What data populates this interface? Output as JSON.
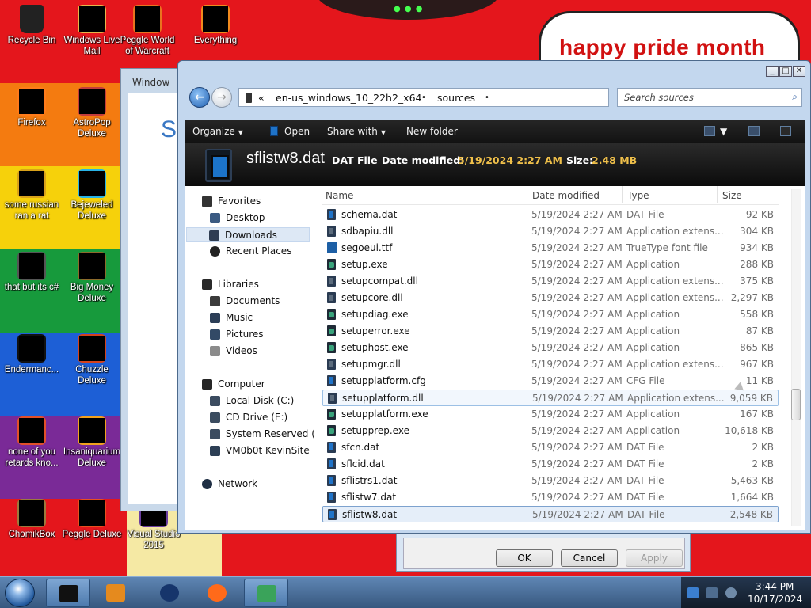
{
  "desktop": {
    "banner_text": "happy pride month",
    "icons": [
      {
        "label": "Recycle Bin",
        "icon": "recycle-bin-icon",
        "color": "#222222"
      },
      {
        "label": "Windows Live Mail",
        "icon": "mail-icon",
        "color": "#e7b54b"
      },
      {
        "label": "Peggle World of Warcraft",
        "icon": "peggle-wow-icon",
        "color": "#e9731f"
      },
      {
        "label": "Everything",
        "icon": "magnifier-icon",
        "color": "#f08a1d"
      },
      {
        "label": "Firefox",
        "icon": "firefox-icon",
        "color": "#ff7b1a"
      },
      {
        "label": "AstroPop Deluxe",
        "icon": "astropop-icon",
        "color": "#c43c3c"
      },
      {
        "label": "some russian ran a rat",
        "icon": "shortcut-icon",
        "color": "#d9a21a"
      },
      {
        "label": "Bejeweled Deluxe",
        "icon": "gem-icon",
        "color": "#29b3e6"
      },
      {
        "label": "that but its c#",
        "icon": "windows-stack-icon",
        "color": "#555555"
      },
      {
        "label": "Big Money Deluxe",
        "icon": "money-bag-icon",
        "color": "#8c6a2b"
      },
      {
        "label": "Endermanc...",
        "icon": "terminal-icon",
        "color": "#111111"
      },
      {
        "label": "Chuzzle Deluxe",
        "icon": "chuzzle-icon",
        "color": "#d4421b"
      },
      {
        "label": "none of you retards kno...",
        "icon": "orange-ball-icon",
        "color": "#e2502a"
      },
      {
        "label": "Insaniquarium Deluxe",
        "icon": "fish-icon",
        "color": "#f2a21f"
      },
      {
        "label": "ChomikBox",
        "icon": "hamster-icon",
        "color": "#9c7a3d"
      },
      {
        "label": "Peggle Deluxe",
        "icon": "peggle-icon",
        "color": "#e8501f"
      },
      {
        "label": "Visual Studio 2015",
        "icon": "visual-studio-icon",
        "color": "#6b3fa0"
      }
    ]
  },
  "background_window": {
    "title": "Window",
    "heading_letter": "Se"
  },
  "properties_dialog": {
    "ok": "OK",
    "cancel": "Cancel",
    "apply": "Apply"
  },
  "explorer": {
    "window_controls": {
      "minimize": "_",
      "maximize": "□",
      "close": "✕"
    },
    "back": "←",
    "forward": "→",
    "address": {
      "chevron": "«",
      "crumbs": [
        "en-us_windows_10_22h2_x64",
        "sources"
      ],
      "separator": "•",
      "dropdown": "▼",
      "refresh": "↻"
    },
    "search": {
      "placeholder": "Search sources",
      "icon": "⌕"
    },
    "toolbar": {
      "organize": "Organize",
      "open": "Open",
      "share_with": "Share with",
      "new_folder": "New folder",
      "caret": "▼"
    },
    "details": {
      "name": "sflistw8.dat",
      "type": "DAT File",
      "modified_label": "Date modified:",
      "modified_value": "5/19/2024 2:27 AM",
      "size_label": "Size:",
      "size_value": "2.48 MB"
    },
    "nav": {
      "favorites": "Favorites",
      "desktop": "Desktop",
      "downloads": "Downloads",
      "recent_places": "Recent Places",
      "libraries": "Libraries",
      "documents": "Documents",
      "music": "Music",
      "pictures": "Pictures",
      "videos": "Videos",
      "computer": "Computer",
      "local_disk": "Local Disk (C:)",
      "cd_drive": "CD Drive (E:)",
      "system_reserved": "System Reserved (F:)",
      "vmshare": "VM0b0t KevinSite",
      "network": "Network"
    },
    "columns": {
      "name": "Name",
      "date": "Date modified",
      "type": "Type",
      "size": "Size",
      "sort_arrow": "^"
    },
    "files": [
      {
        "name": "schema.dat",
        "date": "5/19/2024 2:27 AM",
        "type": "DAT File",
        "size": "92 KB",
        "kind": "dat"
      },
      {
        "name": "sdbapiu.dll",
        "date": "5/19/2024 2:27 AM",
        "type": "Application extens...",
        "size": "304 KB",
        "kind": "dll"
      },
      {
        "name": "segoeui.ttf",
        "date": "5/19/2024 2:27 AM",
        "type": "TrueType font file",
        "size": "934 KB",
        "kind": "font"
      },
      {
        "name": "setup.exe",
        "date": "5/19/2024 2:27 AM",
        "type": "Application",
        "size": "288 KB",
        "kind": "exe"
      },
      {
        "name": "setupcompat.dll",
        "date": "5/19/2024 2:27 AM",
        "type": "Application extens...",
        "size": "375 KB",
        "kind": "dll"
      },
      {
        "name": "setupcore.dll",
        "date": "5/19/2024 2:27 AM",
        "type": "Application extens...",
        "size": "2,297 KB",
        "kind": "dll"
      },
      {
        "name": "setupdiag.exe",
        "date": "5/19/2024 2:27 AM",
        "type": "Application",
        "size": "558 KB",
        "kind": "exe"
      },
      {
        "name": "setuperror.exe",
        "date": "5/19/2024 2:27 AM",
        "type": "Application",
        "size": "87 KB",
        "kind": "exe"
      },
      {
        "name": "setuphost.exe",
        "date": "5/19/2024 2:27 AM",
        "type": "Application",
        "size": "865 KB",
        "kind": "exe"
      },
      {
        "name": "setupmgr.dll",
        "date": "5/19/2024 2:27 AM",
        "type": "Application extens...",
        "size": "967 KB",
        "kind": "dll"
      },
      {
        "name": "setupplatform.cfg",
        "date": "5/19/2024 2:27 AM",
        "type": "CFG File",
        "size": "11 KB",
        "kind": "dat"
      },
      {
        "name": "setupplatform.dll",
        "date": "5/19/2024 2:27 AM",
        "type": "Application extens...",
        "size": "9,059 KB",
        "kind": "dll",
        "state": "outline"
      },
      {
        "name": "setupplatform.exe",
        "date": "5/19/2024 2:27 AM",
        "type": "Application",
        "size": "167 KB",
        "kind": "exe"
      },
      {
        "name": "setupprep.exe",
        "date": "5/19/2024 2:27 AM",
        "type": "Application",
        "size": "10,618 KB",
        "kind": "exe"
      },
      {
        "name": "sfcn.dat",
        "date": "5/19/2024 2:27 AM",
        "type": "DAT File",
        "size": "2 KB",
        "kind": "dat"
      },
      {
        "name": "sflcid.dat",
        "date": "5/19/2024 2:27 AM",
        "type": "DAT File",
        "size": "2 KB",
        "kind": "dat"
      },
      {
        "name": "sflistrs1.dat",
        "date": "5/19/2024 2:27 AM",
        "type": "DAT File",
        "size": "5,463 KB",
        "kind": "dat"
      },
      {
        "name": "sflistw7.dat",
        "date": "5/19/2024 2:27 AM",
        "type": "DAT File",
        "size": "1,664 KB",
        "kind": "dat"
      },
      {
        "name": "sflistw8.dat",
        "date": "5/19/2024 2:27 AM",
        "type": "DAT File",
        "size": "2,548 KB",
        "kind": "dat",
        "state": "focus"
      }
    ]
  },
  "taskbar": {
    "apps": [
      {
        "name": "black-app-icon",
        "color": "#111111",
        "active": true
      },
      {
        "name": "media-player-icon",
        "color": "#e58a1e",
        "active": false
      },
      {
        "name": "globe-icon",
        "color": "#16356b",
        "active": false
      },
      {
        "name": "firefox-icon",
        "color": "#ff6a1a",
        "active": false
      },
      {
        "name": "explorer-app-icon",
        "color": "#3aa35a",
        "active": true
      }
    ],
    "clock": {
      "time": "3:44 PM",
      "date": "10/17/2024"
    }
  }
}
